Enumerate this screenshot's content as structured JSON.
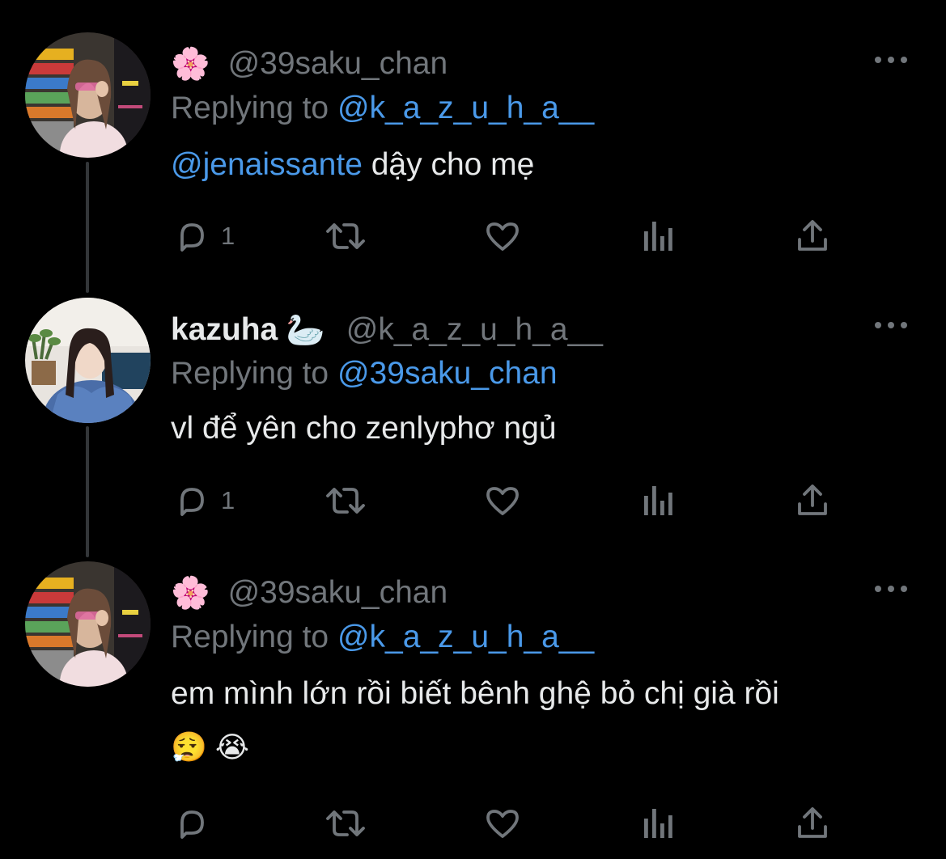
{
  "colors": {
    "background": "#000000",
    "primary_text": "#e7e9ea",
    "secondary_text": "#71767b",
    "mention": "#4a99e9",
    "thread_line": "#333639"
  },
  "tweets": [
    {
      "display_name": "",
      "name_emoji": "🌸",
      "handle": "@39saku_chan",
      "replying_label": "Replying to",
      "replying_to": "@k_a_z_u_h_a__",
      "body_mention": "@jenaissante",
      "body_text": " dậy cho mẹ",
      "reply_count": "1",
      "icons": [
        "reply-icon",
        "retweet-icon",
        "like-icon",
        "views-icon",
        "share-icon",
        "more-icon"
      ]
    },
    {
      "display_name": "kazuha",
      "name_emoji": "🦢",
      "handle": "@k_a_z_u_h_a__",
      "replying_label": "Replying to",
      "replying_to": "@39saku_chan",
      "body_text": "vl để yên cho zenlyphơ ngủ",
      "reply_count": "1",
      "icons": [
        "reply-icon",
        "retweet-icon",
        "like-icon",
        "views-icon",
        "share-icon",
        "more-icon"
      ]
    },
    {
      "display_name": "",
      "name_emoji": "🌸",
      "handle": "@39saku_chan",
      "replying_label": "Replying to",
      "replying_to": "@k_a_z_u_h_a__",
      "body_text": "em mình lớn rồi biết bênh ghệ bỏ chị già rồi",
      "body_emojis": "😮‍💨 😭",
      "reply_count": "",
      "icons": [
        "reply-icon",
        "retweet-icon",
        "like-icon",
        "views-icon",
        "share-icon",
        "more-icon"
      ]
    }
  ]
}
